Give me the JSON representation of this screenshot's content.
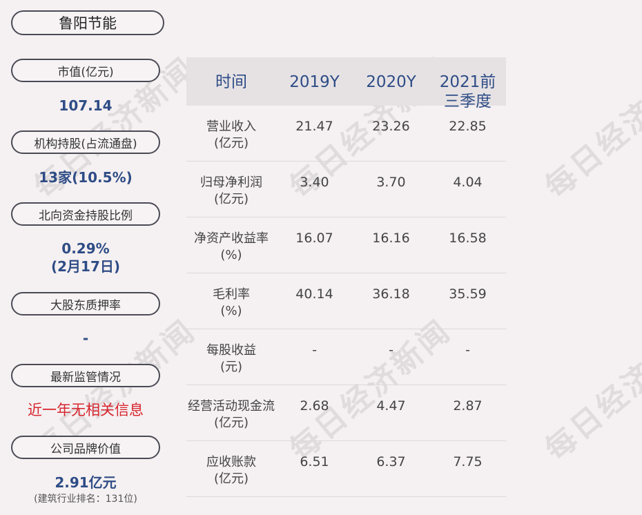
{
  "company": "鲁阳节能",
  "sidebar": [
    {
      "label": "市值(亿元)",
      "value": "107.14"
    },
    {
      "label": "机构持股(占流通盘)",
      "value": "13家(10.5%)"
    },
    {
      "label": "北向资金持股比例",
      "value": "0.29%",
      "value2": "(2月17日)"
    },
    {
      "label": "大股东质押率",
      "value": "-"
    },
    {
      "label": "最新监管情况",
      "value": "近一年无相关信息"
    },
    {
      "label": "公司品牌价值",
      "value": "2.91亿元",
      "sub": "(建筑行业排名：131位)"
    }
  ],
  "table": {
    "headers": [
      "时间",
      "2019Y",
      "2020Y",
      "2021前三季度"
    ],
    "rows": [
      {
        "label": "营业收入",
        "unit": "(亿元)",
        "values": [
          "21.47",
          "23.26",
          "22.85"
        ]
      },
      {
        "label": "归母净利润",
        "unit": "(亿元)",
        "values": [
          "3.40",
          "3.70",
          "4.04"
        ]
      },
      {
        "label": "净资产收益率",
        "unit": "(%)",
        "values": [
          "16.07",
          "16.16",
          "16.58"
        ]
      },
      {
        "label": "毛利率",
        "unit": "(%)",
        "values": [
          "40.14",
          "36.18",
          "35.59"
        ]
      },
      {
        "label": "每股收益",
        "unit": "(元)",
        "values": [
          "-",
          "-",
          "-"
        ]
      },
      {
        "label": "经营活动现金流",
        "unit": "(亿元)",
        "values": [
          "2.68",
          "4.47",
          "2.87"
        ]
      },
      {
        "label": "应收账款",
        "unit": "(亿元)",
        "values": [
          "6.51",
          "6.37",
          "7.75"
        ]
      }
    ]
  },
  "watermark": "每日经济新闻",
  "colors": {
    "accent": "#2e4c86",
    "alert": "#d8252e",
    "background": "#f5f0f1"
  }
}
